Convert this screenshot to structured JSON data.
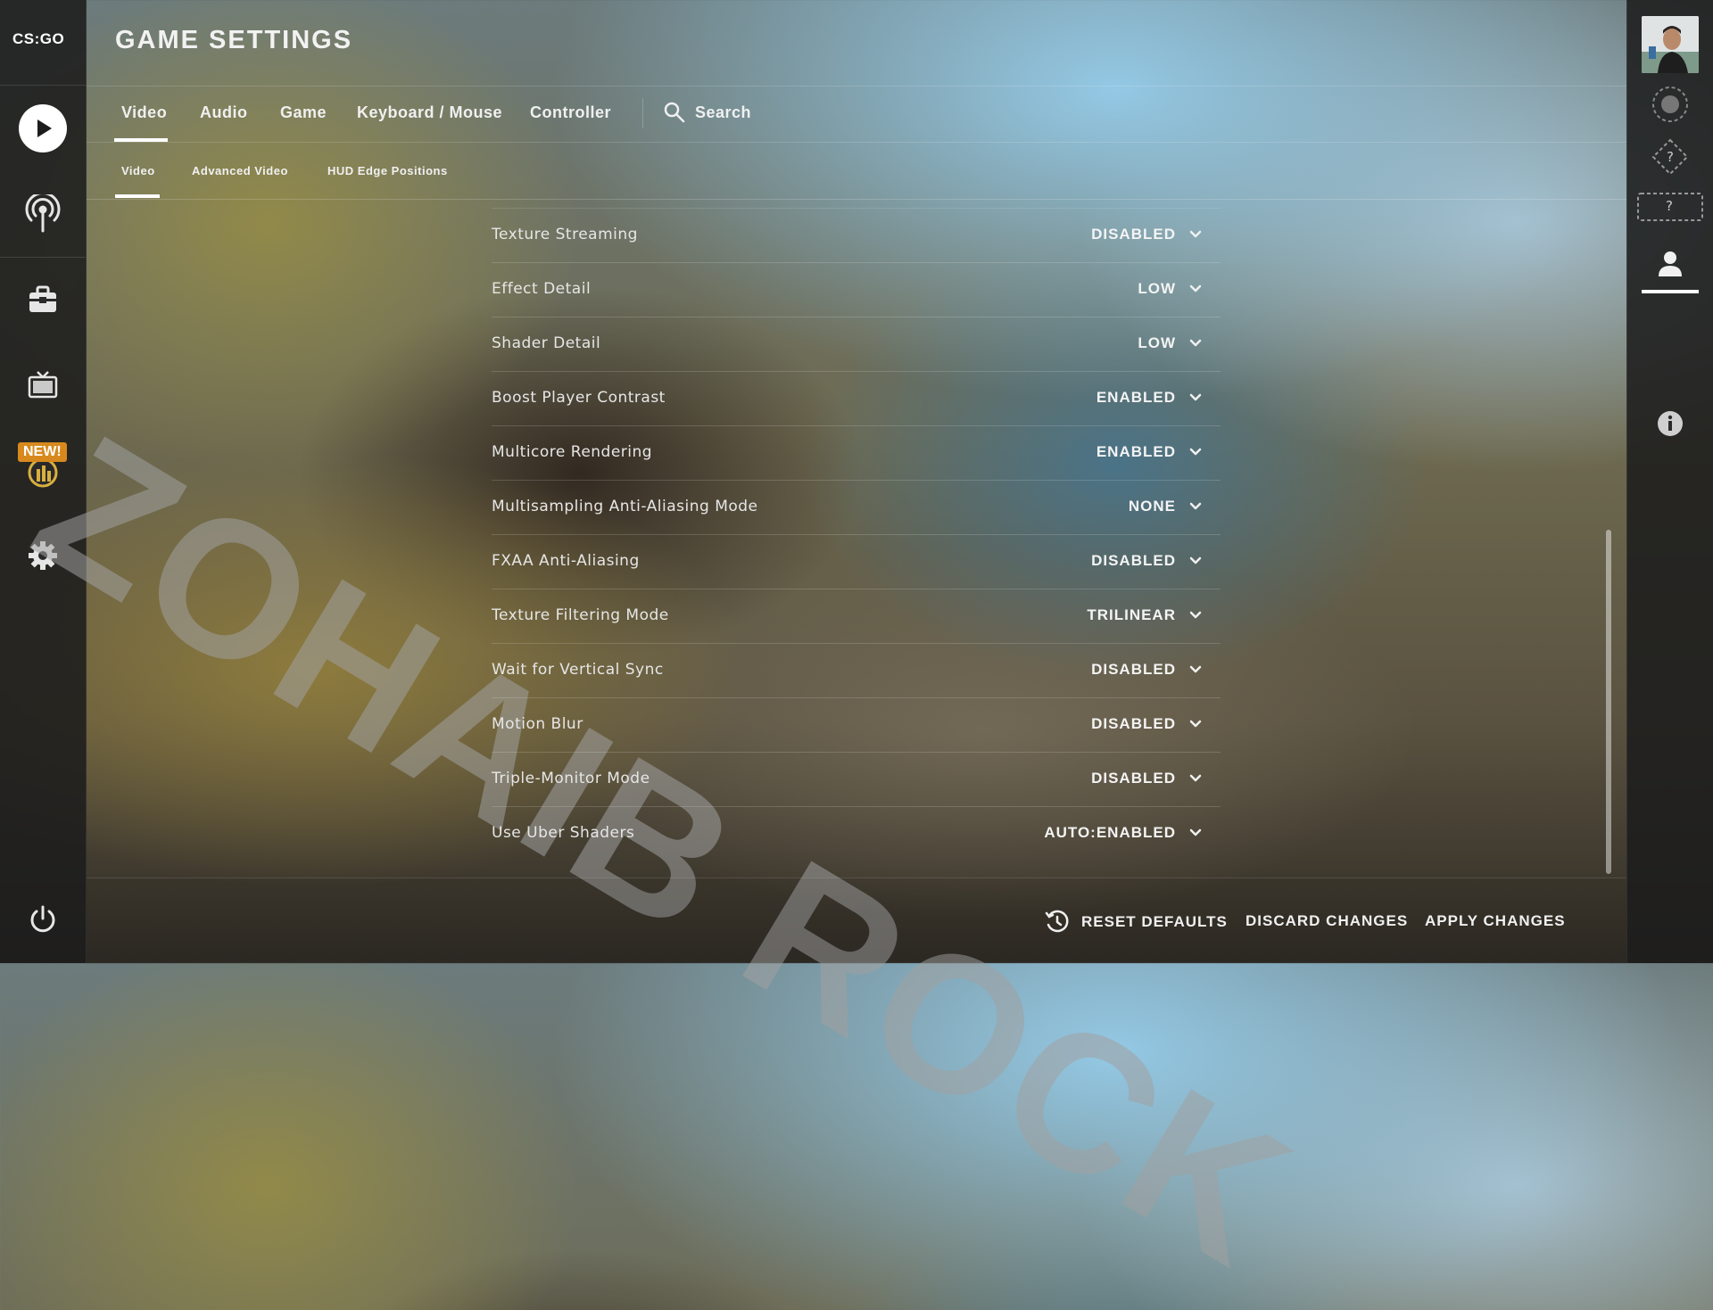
{
  "app": {
    "logo_text": "CS:GO"
  },
  "left_nav": {
    "new_badge": "NEW!",
    "icons": [
      "play-icon",
      "broadcast-icon",
      "briefcase-icon",
      "tv-icon",
      "operation-icon",
      "gear-icon",
      "power-icon"
    ]
  },
  "header": {
    "title": "GAME SETTINGS"
  },
  "tabs": [
    {
      "label": "Video",
      "active": true
    },
    {
      "label": "Audio",
      "active": false
    },
    {
      "label": "Game",
      "active": false
    },
    {
      "label": "Keyboard / Mouse",
      "active": false
    },
    {
      "label": "Controller",
      "active": false
    }
  ],
  "search": {
    "label": "Search"
  },
  "subtabs": [
    {
      "label": "Video",
      "active": true
    },
    {
      "label": "Advanced Video",
      "active": false
    },
    {
      "label": "HUD Edge Positions",
      "active": false
    }
  ],
  "settings": [
    {
      "label": "Texture Streaming",
      "value": "DISABLED"
    },
    {
      "label": "Effect Detail",
      "value": "LOW"
    },
    {
      "label": "Shader Detail",
      "value": "LOW"
    },
    {
      "label": "Boost Player Contrast",
      "value": "ENABLED"
    },
    {
      "label": "Multicore Rendering",
      "value": "ENABLED"
    },
    {
      "label": "Multisampling Anti-Aliasing Mode",
      "value": "NONE"
    },
    {
      "label": "FXAA Anti-Aliasing",
      "value": "DISABLED"
    },
    {
      "label": "Texture Filtering Mode",
      "value": "TRILINEAR"
    },
    {
      "label": "Wait for Vertical Sync",
      "value": "DISABLED"
    },
    {
      "label": "Motion Blur",
      "value": "DISABLED"
    },
    {
      "label": "Triple-Monitor Mode",
      "value": "DISABLED"
    },
    {
      "label": "Use Uber Shaders",
      "value": "AUTO:ENABLED"
    }
  ],
  "footer": {
    "reset_label": "RESET DEFAULTS",
    "discard_label": "DISCARD CHANGES",
    "apply_label": "APPLY CHANGES"
  },
  "right_rail": {
    "rank_question_1": "?",
    "rank_question_2": "?",
    "icons": [
      "avatar",
      "profile-rank-icon",
      "competitive-rank-icon",
      "wingman-rank-icon",
      "friends-icon",
      "info-icon"
    ]
  },
  "watermark": {
    "text": "ZOHAIB ROCK"
  },
  "colors": {
    "accent": "#ffffff",
    "badge": "#d8891d",
    "rail_bg": "#1c1c1c"
  }
}
